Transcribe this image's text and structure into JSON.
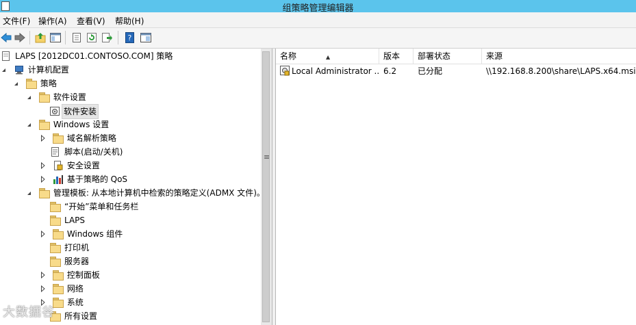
{
  "window": {
    "title": "组策略管理编辑器"
  },
  "menu": {
    "file": "文件(F)",
    "action": "操作(A)",
    "view": "查看(V)",
    "help": "帮助(H)"
  },
  "toolbar": {
    "icons": [
      "back-arrow-icon",
      "forward-arrow-icon",
      "up-folder-icon",
      "show-hide-tree-icon",
      "properties-icon",
      "refresh-icon",
      "export-list-icon",
      "help-icon",
      "extended-view-icon"
    ]
  },
  "tree": {
    "root": "LAPS [2012DC01.CONTOSO.COM] 策略",
    "computer_config": "计算机配置",
    "policies": "策略",
    "software_settings": "软件设置",
    "software_install": "软件安装",
    "windows_settings": "Windows 设置",
    "name_resolution": "域名解析策略",
    "scripts": "脚本(启动/关机)",
    "security_settings": "安全设置",
    "policy_qos": "基于策略的 QoS",
    "admin_templates": "管理模板: 从本地计算机中检索的策略定义(ADMX 文件)。",
    "start_menu": "“开始”菜单和任务栏",
    "laps": "LAPS",
    "windows_components": "Windows 组件",
    "printers": "打印机",
    "server": "服务器",
    "control_panel": "控制面板",
    "network": "网络",
    "system": "系统",
    "all_settings": "所有设置"
  },
  "list": {
    "columns": {
      "name": "名称",
      "version": "版本",
      "deploy_state": "部署状态",
      "source": "来源"
    },
    "rows": [
      {
        "name": "Local Administrator ...",
        "version": "6.2",
        "deploy_state": "已分配",
        "source": "\\\\192.168.8.200\\share\\LAPS.x64.msi"
      }
    ]
  },
  "watermark": "大数据谷"
}
